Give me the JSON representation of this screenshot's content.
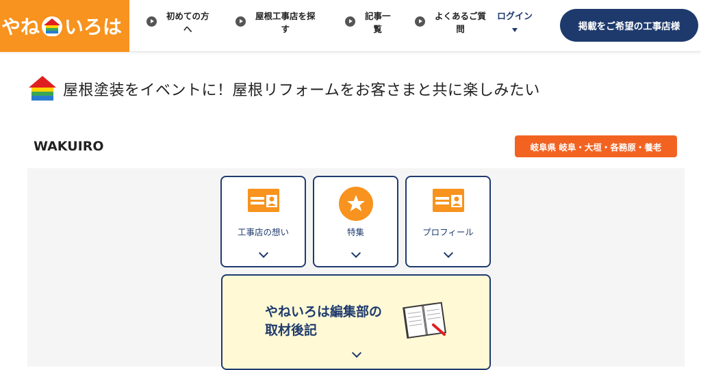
{
  "header": {
    "logo_left": "やね",
    "logo_right": "いろは",
    "nav": [
      {
        "line1": "初めての方",
        "line2": "へ"
      },
      {
        "line1": "屋根工事店を探",
        "line2": "す"
      },
      {
        "line1": "記事一",
        "line2": "覧"
      },
      {
        "line1": "よくあるご質",
        "line2": "問"
      }
    ],
    "login": "ログイン",
    "cta": "掲載をご希望の工事店様"
  },
  "page": {
    "title": "屋根塗装をイベントに！屋根リフォームをお客さまと共に楽しみたい",
    "company": "WAKUIRO",
    "area": "岐阜県 岐阜・大垣・各務原・養老"
  },
  "cards": [
    {
      "label": "工事店の想い",
      "icon": "id-card-icon"
    },
    {
      "label": "特集",
      "icon": "star-icon"
    },
    {
      "label": "プロフィール",
      "icon": "id-card-icon"
    }
  ],
  "feature": {
    "line1": "やねいろは編集部の",
    "line2": "取材後記",
    "icon": "notebook-icon"
  },
  "colors": {
    "brand_orange": "#f7931e",
    "navy": "#1e3a6d",
    "badge_orange": "#f26322",
    "feature_bg": "#fff9d6"
  }
}
